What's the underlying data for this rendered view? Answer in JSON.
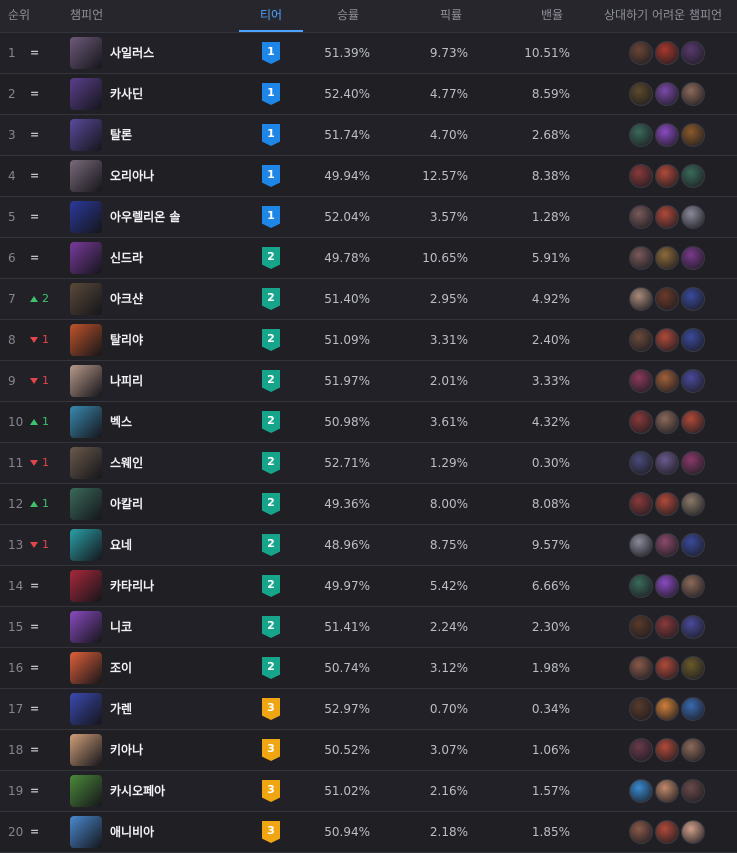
{
  "header": {
    "rank": "순위",
    "champion": "챔피언",
    "tier": "티어",
    "winrate": "승률",
    "pickrate": "픽률",
    "banrate": "밴율",
    "counters": "상대하기 어려운 챔피언"
  },
  "colors": {
    "tier1": "#1e86e6",
    "tier2": "#16a48a",
    "tier3": "#f0a613",
    "up": "#3ec26e",
    "down": "#e2464b"
  },
  "rows": [
    {
      "rank": "1",
      "change_dir": "same",
      "change": "",
      "name": "사일러스",
      "tier": "1",
      "winrate": "51.39%",
      "pickrate": "9.73%",
      "banrate": "10.51%",
      "portrait_color": "#6e5a7a",
      "counter_colors": [
        "#6b4636",
        "#a8382c",
        "#5a3a6e"
      ]
    },
    {
      "rank": "2",
      "change_dir": "same",
      "change": "",
      "name": "카사딘",
      "tier": "1",
      "winrate": "52.40%",
      "pickrate": "4.77%",
      "banrate": "8.59%",
      "portrait_color": "#5a3f8c",
      "counter_colors": [
        "#5c4a2c",
        "#7a4aa8",
        "#8c6a5a"
      ]
    },
    {
      "rank": "3",
      "change_dir": "same",
      "change": "",
      "name": "탈론",
      "tier": "1",
      "winrate": "51.74%",
      "pickrate": "4.70%",
      "banrate": "2.68%",
      "portrait_color": "#5a4a9c",
      "counter_colors": [
        "#3a6a5a",
        "#8a4ac0",
        "#8c5a2a"
      ]
    },
    {
      "rank": "4",
      "change_dir": "same",
      "change": "",
      "name": "오리아나",
      "tier": "1",
      "winrate": "49.94%",
      "pickrate": "12.57%",
      "banrate": "8.38%",
      "portrait_color": "#7a6a7a",
      "counter_colors": [
        "#8a3a3a",
        "#b04a3a",
        "#3a6a5a"
      ]
    },
    {
      "rank": "5",
      "change_dir": "same",
      "change": "",
      "name": "아우렐리온 솔",
      "tier": "1",
      "winrate": "52.04%",
      "pickrate": "3.57%",
      "banrate": "1.28%",
      "portrait_color": "#2a3a9c",
      "counter_colors": [
        "#7a5a5a",
        "#b04a3a",
        "#8a8a9a"
      ]
    },
    {
      "rank": "6",
      "change_dir": "same",
      "change": "",
      "name": "신드라",
      "tier": "2",
      "winrate": "49.78%",
      "pickrate": "10.65%",
      "banrate": "5.91%",
      "portrait_color": "#7a3a9c",
      "counter_colors": [
        "#7a5a5a",
        "#8c6a3a",
        "#7a3a8c"
      ]
    },
    {
      "rank": "7",
      "change_dir": "up",
      "change": "2",
      "name": "아크샨",
      "tier": "2",
      "winrate": "51.40%",
      "pickrate": "2.95%",
      "banrate": "4.92%",
      "portrait_color": "#5a4a3a",
      "counter_colors": [
        "#a88a7a",
        "#6a3a2a",
        "#3a4a9c"
      ]
    },
    {
      "rank": "8",
      "change_dir": "down",
      "change": "1",
      "name": "탈리야",
      "tier": "2",
      "winrate": "51.09%",
      "pickrate": "3.31%",
      "banrate": "2.40%",
      "portrait_color": "#c0542a",
      "counter_colors": [
        "#6a4a3a",
        "#b04a3a",
        "#3a4a9c"
      ]
    },
    {
      "rank": "9",
      "change_dir": "down",
      "change": "1",
      "name": "나피리",
      "tier": "2",
      "winrate": "51.97%",
      "pickrate": "2.01%",
      "banrate": "3.33%",
      "portrait_color": "#b89a8a",
      "counter_colors": [
        "#8a3a5a",
        "#a0603a",
        "#4a4a9c"
      ]
    },
    {
      "rank": "10",
      "change_dir": "up",
      "change": "1",
      "name": "벡스",
      "tier": "2",
      "winrate": "50.98%",
      "pickrate": "3.61%",
      "banrate": "4.32%",
      "portrait_color": "#3a8ab0",
      "counter_colors": [
        "#8a3a3a",
        "#8a6a5a",
        "#b04a3a"
      ]
    },
    {
      "rank": "11",
      "change_dir": "down",
      "change": "1",
      "name": "스웨인",
      "tier": "2",
      "winrate": "52.71%",
      "pickrate": "1.29%",
      "banrate": "0.30%",
      "portrait_color": "#6a5a4a",
      "counter_colors": [
        "#4a4a7a",
        "#6a5a8c",
        "#8a3a6a"
      ]
    },
    {
      "rank": "12",
      "change_dir": "up",
      "change": "1",
      "name": "아칼리",
      "tier": "2",
      "winrate": "49.36%",
      "pickrate": "8.00%",
      "banrate": "8.08%",
      "portrait_color": "#3a6a5a",
      "counter_colors": [
        "#8a3a3a",
        "#b04a3a",
        "#8a7a6a"
      ]
    },
    {
      "rank": "13",
      "change_dir": "down",
      "change": "1",
      "name": "요네",
      "tier": "2",
      "winrate": "48.96%",
      "pickrate": "8.75%",
      "banrate": "9.57%",
      "portrait_color": "#2aa0a8",
      "counter_colors": [
        "#8a8a9a",
        "#8a4a6a",
        "#3a4a9c"
      ]
    },
    {
      "rank": "14",
      "change_dir": "same",
      "change": "",
      "name": "카타리나",
      "tier": "2",
      "winrate": "49.97%",
      "pickrate": "5.42%",
      "banrate": "6.66%",
      "portrait_color": "#a8283a",
      "counter_colors": [
        "#3a6a5a",
        "#8a4ac0",
        "#8c6a5a"
      ]
    },
    {
      "rank": "15",
      "change_dir": "same",
      "change": "",
      "name": "니코",
      "tier": "2",
      "winrate": "51.41%",
      "pickrate": "2.24%",
      "banrate": "2.30%",
      "portrait_color": "#8a4ac0",
      "counter_colors": [
        "#5a3a2a",
        "#8a3a3a",
        "#4a4a9c"
      ]
    },
    {
      "rank": "16",
      "change_dir": "same",
      "change": "",
      "name": "조이",
      "tier": "2",
      "winrate": "50.74%",
      "pickrate": "3.12%",
      "banrate": "1.98%",
      "portrait_color": "#e0603a",
      "counter_colors": [
        "#8a5a4a",
        "#b04a3a",
        "#6a5a2a"
      ]
    },
    {
      "rank": "17",
      "change_dir": "same",
      "change": "",
      "name": "가렌",
      "tier": "3",
      "winrate": "52.97%",
      "pickrate": "0.70%",
      "banrate": "0.34%",
      "portrait_color": "#3a4ab0",
      "counter_colors": [
        "#5a3a2a",
        "#d0803a",
        "#3a6ab0"
      ]
    },
    {
      "rank": "18",
      "change_dir": "same",
      "change": "",
      "name": "키아나",
      "tier": "3",
      "winrate": "50.52%",
      "pickrate": "3.07%",
      "banrate": "1.06%",
      "portrait_color": "#d0a07a",
      "counter_colors": [
        "#6a3a4a",
        "#b04a3a",
        "#8c6a5a"
      ]
    },
    {
      "rank": "19",
      "change_dir": "same",
      "change": "",
      "name": "카시오페아",
      "tier": "3",
      "winrate": "51.02%",
      "pickrate": "2.16%",
      "banrate": "1.57%",
      "portrait_color": "#4a8a3a",
      "counter_colors": [
        "#3a8ad0",
        "#c08a6a",
        "#6a4a4a"
      ]
    },
    {
      "rank": "20",
      "change_dir": "same",
      "change": "",
      "name": "애니비아",
      "tier": "3",
      "winrate": "50.94%",
      "pickrate": "2.18%",
      "banrate": "1.85%",
      "portrait_color": "#4a8ad0",
      "counter_colors": [
        "#8a5a4a",
        "#b04a3a",
        "#d0a08a"
      ]
    }
  ]
}
